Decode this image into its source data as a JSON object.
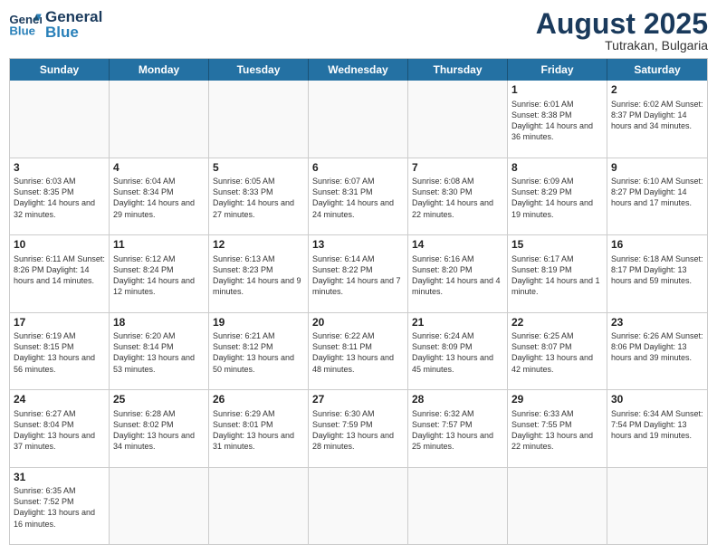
{
  "header": {
    "logo_general": "General",
    "logo_blue": "Blue",
    "month_title": "August 2025",
    "location": "Tutrakan, Bulgaria"
  },
  "days_of_week": [
    "Sunday",
    "Monday",
    "Tuesday",
    "Wednesday",
    "Thursday",
    "Friday",
    "Saturday"
  ],
  "weeks": [
    [
      {
        "day": "",
        "info": ""
      },
      {
        "day": "",
        "info": ""
      },
      {
        "day": "",
        "info": ""
      },
      {
        "day": "",
        "info": ""
      },
      {
        "day": "",
        "info": ""
      },
      {
        "day": "1",
        "info": "Sunrise: 6:01 AM\nSunset: 8:38 PM\nDaylight: 14 hours and 36 minutes."
      },
      {
        "day": "2",
        "info": "Sunrise: 6:02 AM\nSunset: 8:37 PM\nDaylight: 14 hours and 34 minutes."
      }
    ],
    [
      {
        "day": "3",
        "info": "Sunrise: 6:03 AM\nSunset: 8:35 PM\nDaylight: 14 hours and 32 minutes."
      },
      {
        "day": "4",
        "info": "Sunrise: 6:04 AM\nSunset: 8:34 PM\nDaylight: 14 hours and 29 minutes."
      },
      {
        "day": "5",
        "info": "Sunrise: 6:05 AM\nSunset: 8:33 PM\nDaylight: 14 hours and 27 minutes."
      },
      {
        "day": "6",
        "info": "Sunrise: 6:07 AM\nSunset: 8:31 PM\nDaylight: 14 hours and 24 minutes."
      },
      {
        "day": "7",
        "info": "Sunrise: 6:08 AM\nSunset: 8:30 PM\nDaylight: 14 hours and 22 minutes."
      },
      {
        "day": "8",
        "info": "Sunrise: 6:09 AM\nSunset: 8:29 PM\nDaylight: 14 hours and 19 minutes."
      },
      {
        "day": "9",
        "info": "Sunrise: 6:10 AM\nSunset: 8:27 PM\nDaylight: 14 hours and 17 minutes."
      }
    ],
    [
      {
        "day": "10",
        "info": "Sunrise: 6:11 AM\nSunset: 8:26 PM\nDaylight: 14 hours and 14 minutes."
      },
      {
        "day": "11",
        "info": "Sunrise: 6:12 AM\nSunset: 8:24 PM\nDaylight: 14 hours and 12 minutes."
      },
      {
        "day": "12",
        "info": "Sunrise: 6:13 AM\nSunset: 8:23 PM\nDaylight: 14 hours and 9 minutes."
      },
      {
        "day": "13",
        "info": "Sunrise: 6:14 AM\nSunset: 8:22 PM\nDaylight: 14 hours and 7 minutes."
      },
      {
        "day": "14",
        "info": "Sunrise: 6:16 AM\nSunset: 8:20 PM\nDaylight: 14 hours and 4 minutes."
      },
      {
        "day": "15",
        "info": "Sunrise: 6:17 AM\nSunset: 8:19 PM\nDaylight: 14 hours and 1 minute."
      },
      {
        "day": "16",
        "info": "Sunrise: 6:18 AM\nSunset: 8:17 PM\nDaylight: 13 hours and 59 minutes."
      }
    ],
    [
      {
        "day": "17",
        "info": "Sunrise: 6:19 AM\nSunset: 8:15 PM\nDaylight: 13 hours and 56 minutes."
      },
      {
        "day": "18",
        "info": "Sunrise: 6:20 AM\nSunset: 8:14 PM\nDaylight: 13 hours and 53 minutes."
      },
      {
        "day": "19",
        "info": "Sunrise: 6:21 AM\nSunset: 8:12 PM\nDaylight: 13 hours and 50 minutes."
      },
      {
        "day": "20",
        "info": "Sunrise: 6:22 AM\nSunset: 8:11 PM\nDaylight: 13 hours and 48 minutes."
      },
      {
        "day": "21",
        "info": "Sunrise: 6:24 AM\nSunset: 8:09 PM\nDaylight: 13 hours and 45 minutes."
      },
      {
        "day": "22",
        "info": "Sunrise: 6:25 AM\nSunset: 8:07 PM\nDaylight: 13 hours and 42 minutes."
      },
      {
        "day": "23",
        "info": "Sunrise: 6:26 AM\nSunset: 8:06 PM\nDaylight: 13 hours and 39 minutes."
      }
    ],
    [
      {
        "day": "24",
        "info": "Sunrise: 6:27 AM\nSunset: 8:04 PM\nDaylight: 13 hours and 37 minutes."
      },
      {
        "day": "25",
        "info": "Sunrise: 6:28 AM\nSunset: 8:02 PM\nDaylight: 13 hours and 34 minutes."
      },
      {
        "day": "26",
        "info": "Sunrise: 6:29 AM\nSunset: 8:01 PM\nDaylight: 13 hours and 31 minutes."
      },
      {
        "day": "27",
        "info": "Sunrise: 6:30 AM\nSunset: 7:59 PM\nDaylight: 13 hours and 28 minutes."
      },
      {
        "day": "28",
        "info": "Sunrise: 6:32 AM\nSunset: 7:57 PM\nDaylight: 13 hours and 25 minutes."
      },
      {
        "day": "29",
        "info": "Sunrise: 6:33 AM\nSunset: 7:55 PM\nDaylight: 13 hours and 22 minutes."
      },
      {
        "day": "30",
        "info": "Sunrise: 6:34 AM\nSunset: 7:54 PM\nDaylight: 13 hours and 19 minutes."
      }
    ],
    [
      {
        "day": "31",
        "info": "Sunrise: 6:35 AM\nSunset: 7:52 PM\nDaylight: 13 hours and 16 minutes."
      },
      {
        "day": "",
        "info": ""
      },
      {
        "day": "",
        "info": ""
      },
      {
        "day": "",
        "info": ""
      },
      {
        "day": "",
        "info": ""
      },
      {
        "day": "",
        "info": ""
      },
      {
        "day": "",
        "info": ""
      }
    ]
  ]
}
